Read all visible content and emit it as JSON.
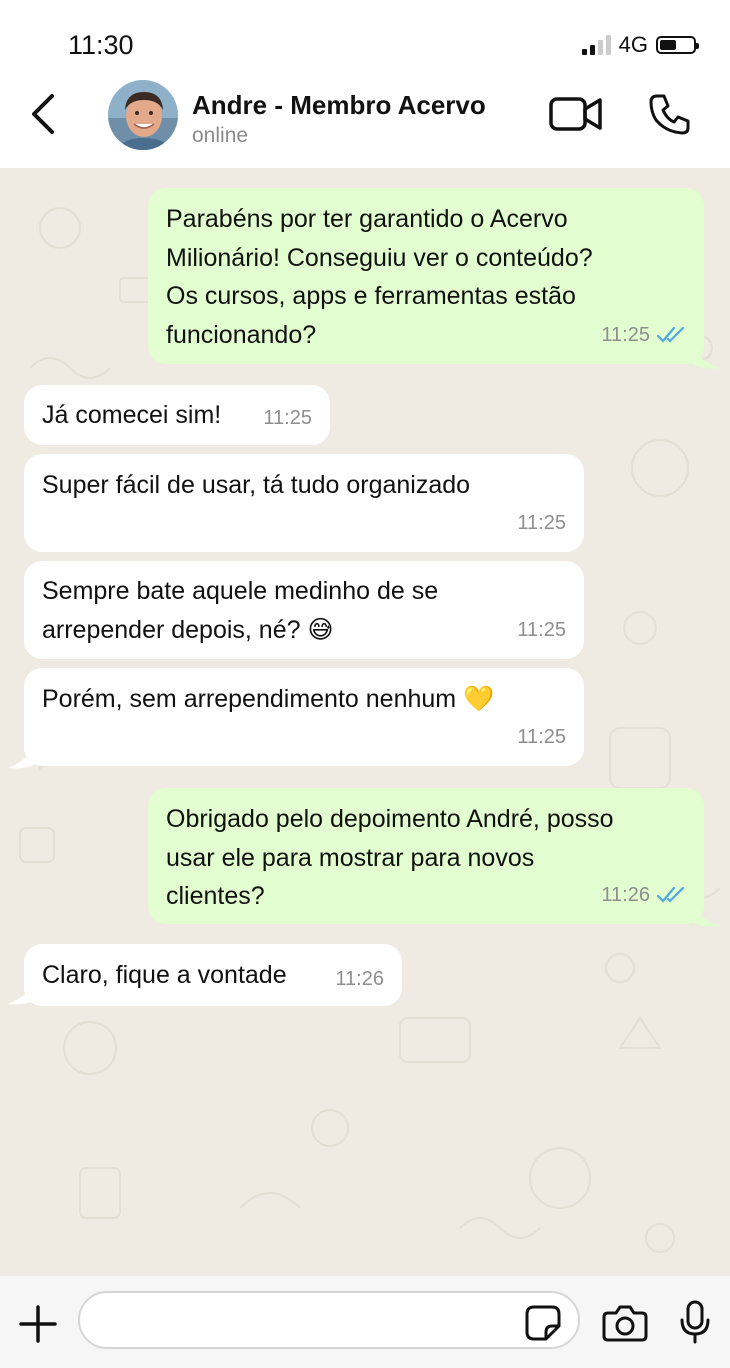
{
  "status_bar": {
    "time": "11:30",
    "network": "4G"
  },
  "header": {
    "contact_name": "Andre - Membro Acervo",
    "status": "online"
  },
  "messages": [
    {
      "direction": "out",
      "lines": [
        "Parabéns por ter garantido o Acervo",
        "Milionário! Conseguiu ver o conteúdo?",
        "Os cursos, apps e ferramentas estão",
        "funcionando?"
      ],
      "time": "11:25",
      "read": true
    },
    {
      "direction": "in",
      "lines": [
        "Já comecei sim!"
      ],
      "time": "11:25"
    },
    {
      "direction": "in",
      "lines": [
        "Super fácil de usar, tá tudo organizado"
      ],
      "time": "11:25"
    },
    {
      "direction": "in",
      "lines": [
        "Sempre bate aquele medinho de se",
        "arrepender depois, né? 😅"
      ],
      "time": "11:25"
    },
    {
      "direction": "in",
      "lines": [
        "Porém, sem arrependimento nenhum 💛"
      ],
      "time": "11:25"
    },
    {
      "direction": "out",
      "lines": [
        "Obrigado pelo depoimento André, posso",
        "usar ele para mostrar para novos",
        "clientes?"
      ],
      "time": "11:26",
      "read": true
    },
    {
      "direction": "in",
      "lines": [
        "Claro, fique a vontade"
      ],
      "time": "11:26"
    }
  ],
  "input": {
    "placeholder": ""
  },
  "colors": {
    "outgoing_bubble": "#e2fdd0",
    "incoming_bubble": "#ffffff",
    "chat_background": "#efeae2",
    "read_ticks": "#4fa6e8"
  }
}
